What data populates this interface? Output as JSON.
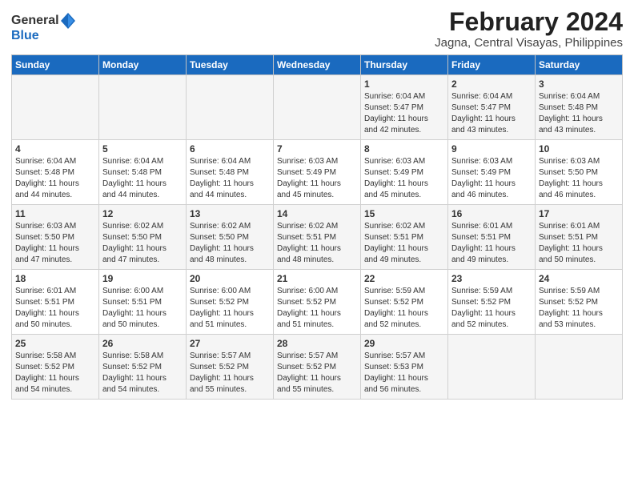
{
  "logo": {
    "general": "General",
    "blue": "Blue"
  },
  "title": "February 2024",
  "subtitle": "Jagna, Central Visayas, Philippines",
  "weekdays": [
    "Sunday",
    "Monday",
    "Tuesday",
    "Wednesday",
    "Thursday",
    "Friday",
    "Saturday"
  ],
  "weeks": [
    [
      {
        "day": "",
        "info": ""
      },
      {
        "day": "",
        "info": ""
      },
      {
        "day": "",
        "info": ""
      },
      {
        "day": "",
        "info": ""
      },
      {
        "day": "1",
        "info": "Sunrise: 6:04 AM\nSunset: 5:47 PM\nDaylight: 11 hours\nand 42 minutes."
      },
      {
        "day": "2",
        "info": "Sunrise: 6:04 AM\nSunset: 5:47 PM\nDaylight: 11 hours\nand 43 minutes."
      },
      {
        "day": "3",
        "info": "Sunrise: 6:04 AM\nSunset: 5:48 PM\nDaylight: 11 hours\nand 43 minutes."
      }
    ],
    [
      {
        "day": "4",
        "info": "Sunrise: 6:04 AM\nSunset: 5:48 PM\nDaylight: 11 hours\nand 44 minutes."
      },
      {
        "day": "5",
        "info": "Sunrise: 6:04 AM\nSunset: 5:48 PM\nDaylight: 11 hours\nand 44 minutes."
      },
      {
        "day": "6",
        "info": "Sunrise: 6:04 AM\nSunset: 5:48 PM\nDaylight: 11 hours\nand 44 minutes."
      },
      {
        "day": "7",
        "info": "Sunrise: 6:03 AM\nSunset: 5:49 PM\nDaylight: 11 hours\nand 45 minutes."
      },
      {
        "day": "8",
        "info": "Sunrise: 6:03 AM\nSunset: 5:49 PM\nDaylight: 11 hours\nand 45 minutes."
      },
      {
        "day": "9",
        "info": "Sunrise: 6:03 AM\nSunset: 5:49 PM\nDaylight: 11 hours\nand 46 minutes."
      },
      {
        "day": "10",
        "info": "Sunrise: 6:03 AM\nSunset: 5:50 PM\nDaylight: 11 hours\nand 46 minutes."
      }
    ],
    [
      {
        "day": "11",
        "info": "Sunrise: 6:03 AM\nSunset: 5:50 PM\nDaylight: 11 hours\nand 47 minutes."
      },
      {
        "day": "12",
        "info": "Sunrise: 6:02 AM\nSunset: 5:50 PM\nDaylight: 11 hours\nand 47 minutes."
      },
      {
        "day": "13",
        "info": "Sunrise: 6:02 AM\nSunset: 5:50 PM\nDaylight: 11 hours\nand 48 minutes."
      },
      {
        "day": "14",
        "info": "Sunrise: 6:02 AM\nSunset: 5:51 PM\nDaylight: 11 hours\nand 48 minutes."
      },
      {
        "day": "15",
        "info": "Sunrise: 6:02 AM\nSunset: 5:51 PM\nDaylight: 11 hours\nand 49 minutes."
      },
      {
        "day": "16",
        "info": "Sunrise: 6:01 AM\nSunset: 5:51 PM\nDaylight: 11 hours\nand 49 minutes."
      },
      {
        "day": "17",
        "info": "Sunrise: 6:01 AM\nSunset: 5:51 PM\nDaylight: 11 hours\nand 50 minutes."
      }
    ],
    [
      {
        "day": "18",
        "info": "Sunrise: 6:01 AM\nSunset: 5:51 PM\nDaylight: 11 hours\nand 50 minutes."
      },
      {
        "day": "19",
        "info": "Sunrise: 6:00 AM\nSunset: 5:51 PM\nDaylight: 11 hours\nand 50 minutes."
      },
      {
        "day": "20",
        "info": "Sunrise: 6:00 AM\nSunset: 5:52 PM\nDaylight: 11 hours\nand 51 minutes."
      },
      {
        "day": "21",
        "info": "Sunrise: 6:00 AM\nSunset: 5:52 PM\nDaylight: 11 hours\nand 51 minutes."
      },
      {
        "day": "22",
        "info": "Sunrise: 5:59 AM\nSunset: 5:52 PM\nDaylight: 11 hours\nand 52 minutes."
      },
      {
        "day": "23",
        "info": "Sunrise: 5:59 AM\nSunset: 5:52 PM\nDaylight: 11 hours\nand 52 minutes."
      },
      {
        "day": "24",
        "info": "Sunrise: 5:59 AM\nSunset: 5:52 PM\nDaylight: 11 hours\nand 53 minutes."
      }
    ],
    [
      {
        "day": "25",
        "info": "Sunrise: 5:58 AM\nSunset: 5:52 PM\nDaylight: 11 hours\nand 54 minutes."
      },
      {
        "day": "26",
        "info": "Sunrise: 5:58 AM\nSunset: 5:52 PM\nDaylight: 11 hours\nand 54 minutes."
      },
      {
        "day": "27",
        "info": "Sunrise: 5:57 AM\nSunset: 5:52 PM\nDaylight: 11 hours\nand 55 minutes."
      },
      {
        "day": "28",
        "info": "Sunrise: 5:57 AM\nSunset: 5:52 PM\nDaylight: 11 hours\nand 55 minutes."
      },
      {
        "day": "29",
        "info": "Sunrise: 5:57 AM\nSunset: 5:53 PM\nDaylight: 11 hours\nand 56 minutes."
      },
      {
        "day": "",
        "info": ""
      },
      {
        "day": "",
        "info": ""
      }
    ]
  ]
}
